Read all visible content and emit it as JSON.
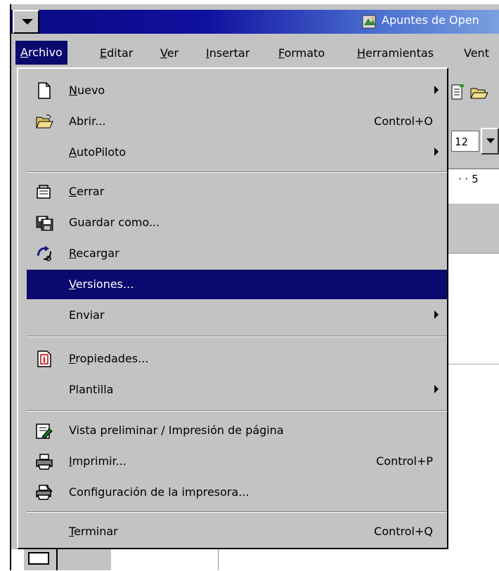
{
  "window": {
    "title": "Apuntes de Open"
  },
  "menubar": {
    "items": [
      "Archivo",
      "Editar",
      "Ver",
      "Insertar",
      "Formato",
      "Herramientas",
      "Vent"
    ]
  },
  "toolbar": {
    "font_size": "12",
    "ruler_text": "· · 5"
  },
  "file_menu": {
    "items": [
      {
        "label": "Nuevo",
        "shortcut": "",
        "submenu": true,
        "icon": "new-document-icon"
      },
      {
        "label": "Abrir...",
        "shortcut": "Control+O",
        "submenu": false,
        "icon": "open-folder-icon"
      },
      {
        "label": "AutoPiloto",
        "shortcut": "",
        "submenu": true,
        "icon": ""
      },
      {
        "label": "Cerrar",
        "shortcut": "",
        "submenu": false,
        "icon": "close-document-icon"
      },
      {
        "label": "Guardar como...",
        "shortcut": "",
        "submenu": false,
        "icon": "save-as-icon"
      },
      {
        "label": "Recargar",
        "shortcut": "",
        "submenu": false,
        "icon": "reload-icon"
      },
      {
        "label": "Versiones...",
        "shortcut": "",
        "submenu": false,
        "icon": "",
        "highlighted": true
      },
      {
        "label": "Enviar",
        "shortcut": "",
        "submenu": true,
        "icon": ""
      },
      {
        "label": "Propiedades...",
        "shortcut": "",
        "submenu": false,
        "icon": "properties-icon"
      },
      {
        "label": "Plantilla",
        "shortcut": "",
        "submenu": true,
        "icon": ""
      },
      {
        "label": "Vista preliminar / Impresión de página",
        "shortcut": "",
        "submenu": false,
        "icon": "print-preview-icon"
      },
      {
        "label": "Imprimir...",
        "shortcut": "Control+P",
        "submenu": false,
        "icon": "printer-icon"
      },
      {
        "label": "Configuración de la impresora...",
        "shortcut": "",
        "submenu": false,
        "icon": "printer-settings-icon"
      },
      {
        "label": "Terminar",
        "shortcut": "Control+Q",
        "submenu": false,
        "icon": ""
      }
    ]
  },
  "colors": {
    "menu_bg": "#c3c3c3",
    "highlight": "#0a0a6e",
    "title_dark": "#0a0a80",
    "title_light": "#7aa0e0"
  }
}
